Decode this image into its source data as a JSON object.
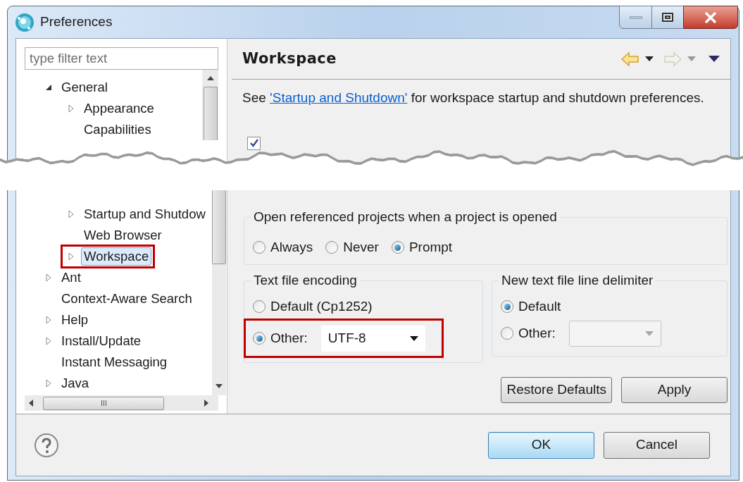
{
  "window": {
    "title": "Preferences"
  },
  "filter": {
    "placeholder": "type filter text"
  },
  "tree": [
    {
      "label": "General",
      "expandable": true,
      "expanded": true,
      "selected": false,
      "highlighted": false,
      "children": [
        {
          "label": "Appearance",
          "expandable": true,
          "expanded": false,
          "selected": false,
          "highlighted": false
        },
        {
          "label": "Capabilities",
          "expandable": false,
          "selected": false,
          "highlighted": false
        },
        {
          "label": "Startup and Shutdow",
          "expandable": true,
          "expanded": false,
          "selected": false,
          "highlighted": false
        },
        {
          "label": "Web Browser",
          "expandable": false,
          "selected": false,
          "highlighted": false
        },
        {
          "label": "Workspace",
          "expandable": true,
          "expanded": false,
          "selected": true,
          "highlighted": true
        }
      ]
    },
    {
      "label": "Ant",
      "expandable": true,
      "expanded": false,
      "selected": false,
      "highlighted": false
    },
    {
      "label": "Context-Aware Search",
      "expandable": false,
      "selected": false,
      "highlighted": false
    },
    {
      "label": "Help",
      "expandable": true,
      "expanded": false,
      "selected": false,
      "highlighted": false
    },
    {
      "label": "Install/Update",
      "expandable": true,
      "expanded": false,
      "selected": false,
      "highlighted": false
    },
    {
      "label": "Instant Messaging",
      "expandable": false,
      "selected": false,
      "highlighted": false
    },
    {
      "label": "Java",
      "expandable": true,
      "expanded": false,
      "selected": false,
      "highlighted": false
    }
  ],
  "page": {
    "title": "Workspace",
    "intro_before": "See",
    "link": "'Startup and Shutdown'",
    "intro_after": "for workspace startup and shutdown preferences.",
    "checkbox": {
      "checked": true
    }
  },
  "open_projects": {
    "title": "Open referenced projects when a project is opened",
    "options": [
      {
        "label": "Always",
        "selected": false
      },
      {
        "label": "Never",
        "selected": false
      },
      {
        "label": "Prompt",
        "selected": true
      }
    ]
  },
  "encoding": {
    "title": "Text file encoding",
    "options": [
      {
        "kind": "radio",
        "label": "Default (Cp1252)",
        "selected": false,
        "highlighted": false
      },
      {
        "kind": "combo",
        "label": "Other:",
        "selected": true,
        "value": "UTF-8",
        "disabled": false,
        "highlighted": true
      }
    ]
  },
  "line_delimiter": {
    "title": "New text file line delimiter",
    "options": [
      {
        "kind": "radio",
        "label": "Default",
        "selected": true,
        "highlighted": false
      },
      {
        "kind": "combo",
        "label": "Other:",
        "selected": false,
        "disabled": true,
        "highlighted": false
      }
    ]
  },
  "page_buttons": [
    "Restore Defaults",
    "Apply"
  ],
  "dialog_buttons": [
    {
      "label": "OK",
      "default": true
    },
    {
      "label": "Cancel",
      "default": false
    }
  ]
}
